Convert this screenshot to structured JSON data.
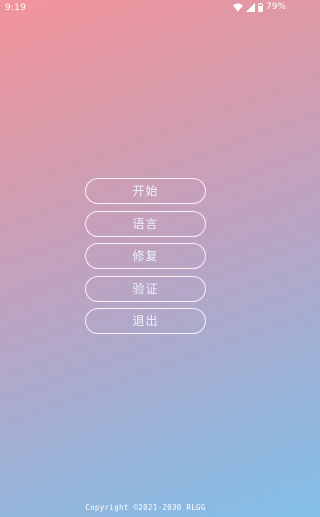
{
  "status_bar": {
    "time": "9:19",
    "icons": [
      "wifi-icon",
      "signal-icon",
      "battery-icon"
    ],
    "battery_percent": "79%"
  },
  "menu": {
    "items": [
      {
        "label": "开始"
      },
      {
        "label": "语言"
      },
      {
        "label": "修复"
      },
      {
        "label": "验证"
      },
      {
        "label": "退出"
      }
    ]
  },
  "footer": {
    "copyright": "Copyright ©2021-2030 RLGG"
  },
  "colors": {
    "gradient_top": "#f3939d",
    "gradient_bottom": "#82bfe8",
    "button_border": "#ffffff",
    "button_text": "#eef3f8"
  }
}
